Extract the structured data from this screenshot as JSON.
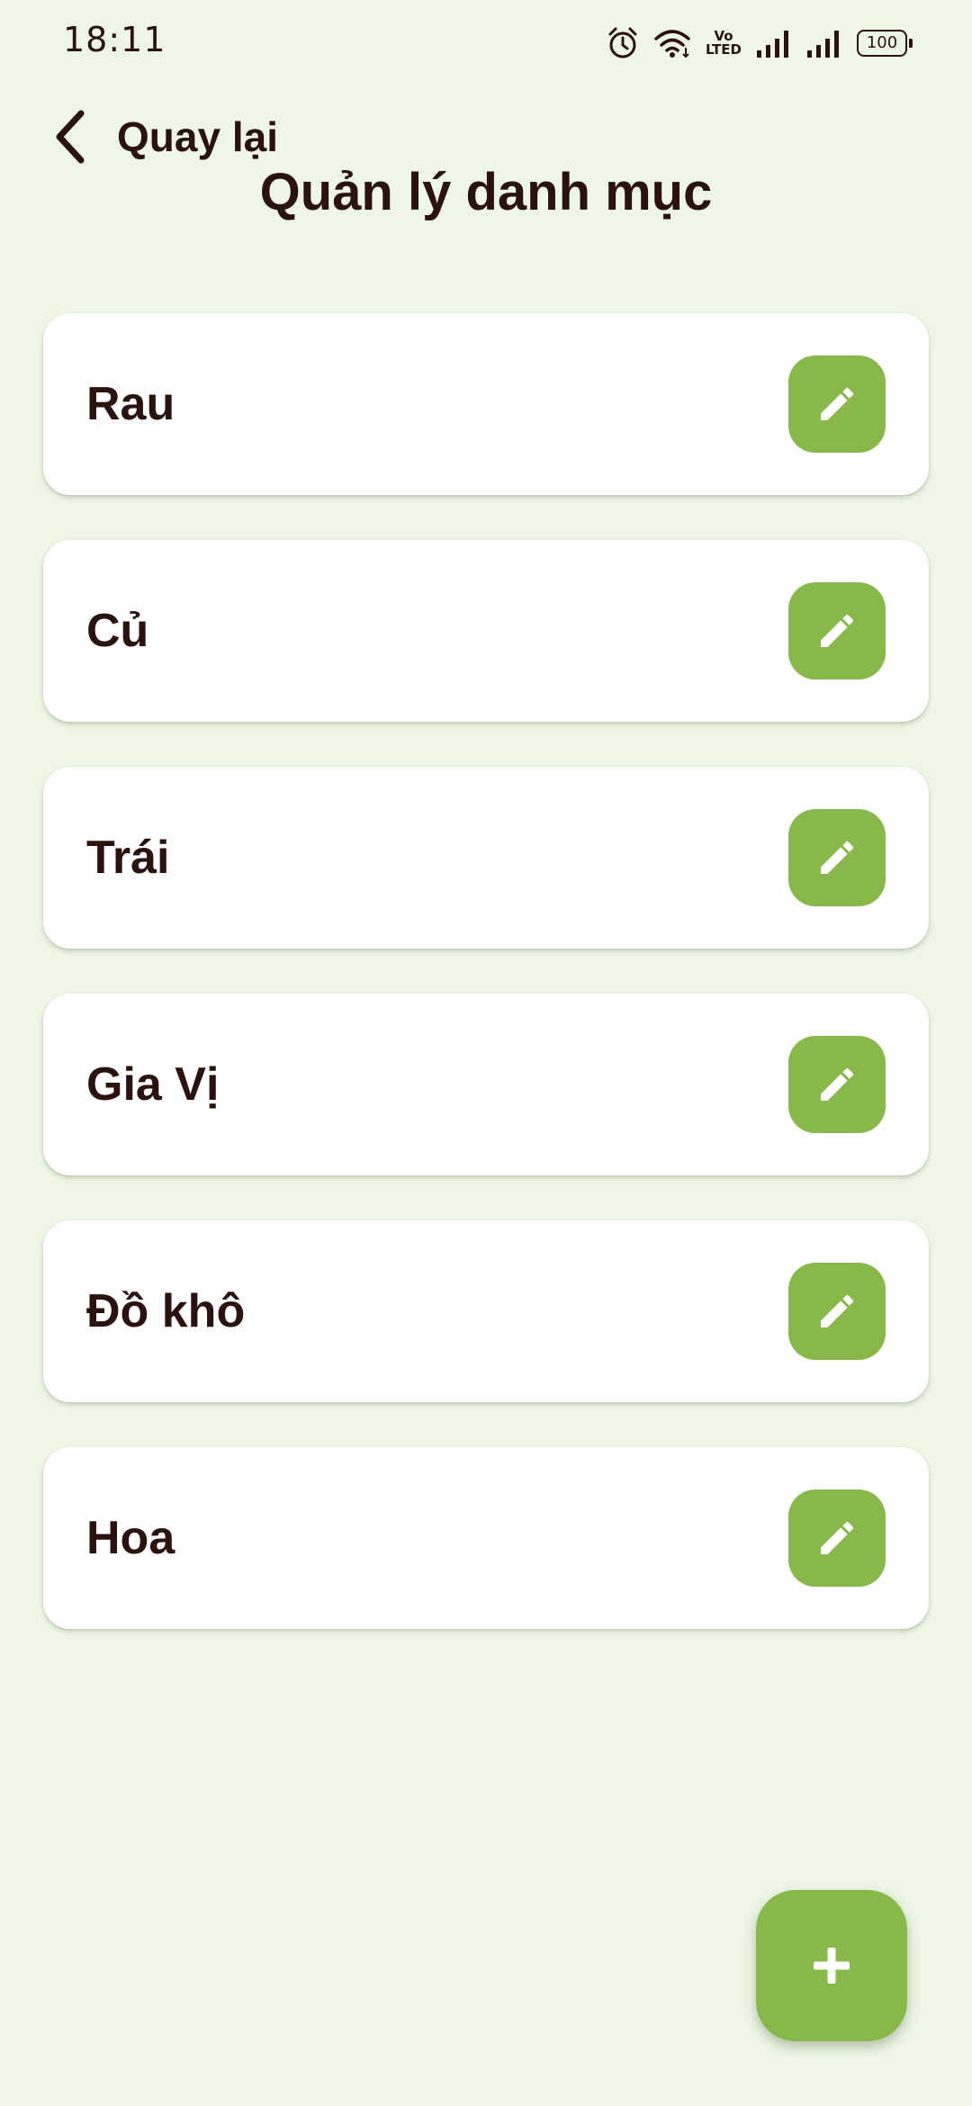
{
  "status_bar": {
    "time": "18:11",
    "volte_top": "Vo",
    "volte_bottom": "LTED",
    "battery": "100",
    "icons": [
      "alarm-icon",
      "wifi-icon",
      "volte-icon",
      "signal-icon",
      "signal-icon",
      "battery-icon"
    ]
  },
  "header": {
    "back_label": "Quay lại",
    "back_icon": "chevron-left-icon",
    "title": "Quản lý danh mục"
  },
  "categories": [
    {
      "name": "Rau",
      "action_icon": "pencil-icon"
    },
    {
      "name": "Củ",
      "action_icon": "pencil-icon"
    },
    {
      "name": "Trái",
      "action_icon": "pencil-icon"
    },
    {
      "name": "Gia Vị",
      "action_icon": "pencil-icon"
    },
    {
      "name": "Đồ khô",
      "action_icon": "pencil-icon"
    },
    {
      "name": "Hoa",
      "action_icon": "pencil-icon"
    }
  ],
  "fab": {
    "icon": "plus-icon"
  },
  "colors": {
    "background": "#eef7e6",
    "card": "#ffffff",
    "accent_green": "#88b74a",
    "text_dark": "#2a120f"
  }
}
